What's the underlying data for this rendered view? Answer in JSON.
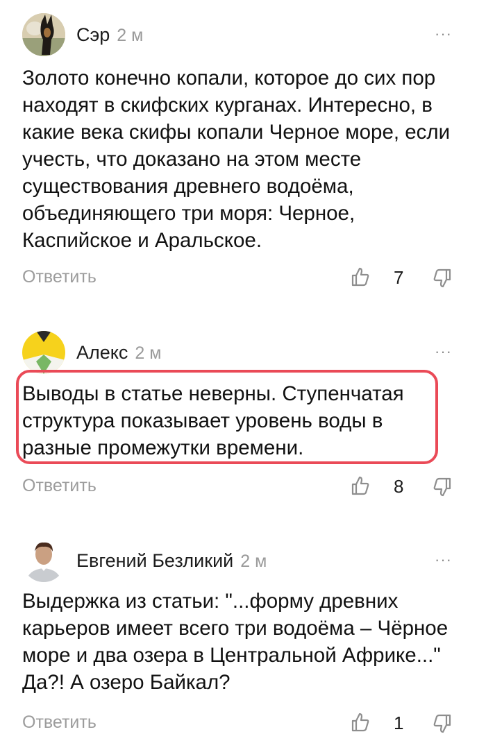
{
  "comments": [
    {
      "author": "Сэр",
      "time": "2 м",
      "text": "Золото конечно копали, которое до сих пор находят в скифских курганах. Интересно, в какие века скифы копали Черное море, если учесть, что доказано на этом месте существования древнего водоёма, объединяющего три моря: Черное, Каспийское и Аральское.",
      "reply_label": "Ответить",
      "likes": "7",
      "avatar_icon": "dog-photo-avatar",
      "more_label": "···"
    },
    {
      "author": "Алекс",
      "time": "2 м",
      "text": "Выводы в статье неверны. Ступенчатая структура показывает уровень воды в разные промежутки времени.",
      "reply_label": "Ответить",
      "likes": "8",
      "avatar_icon": "geometric-avatar",
      "more_label": "···",
      "highlight_color": "#ea4a57"
    },
    {
      "author": "Евгений Безликий",
      "time": "2 м",
      "text": "Выдержка из статьи: \"...форму древних карьеров имеет всего три водоёма – Чёрное море и два озера в Центральной Африке...\" Да?! А озеро Байкал?",
      "reply_label": "Ответить",
      "likes": "1",
      "avatar_icon": "person-avatar",
      "more_label": "···"
    }
  ]
}
